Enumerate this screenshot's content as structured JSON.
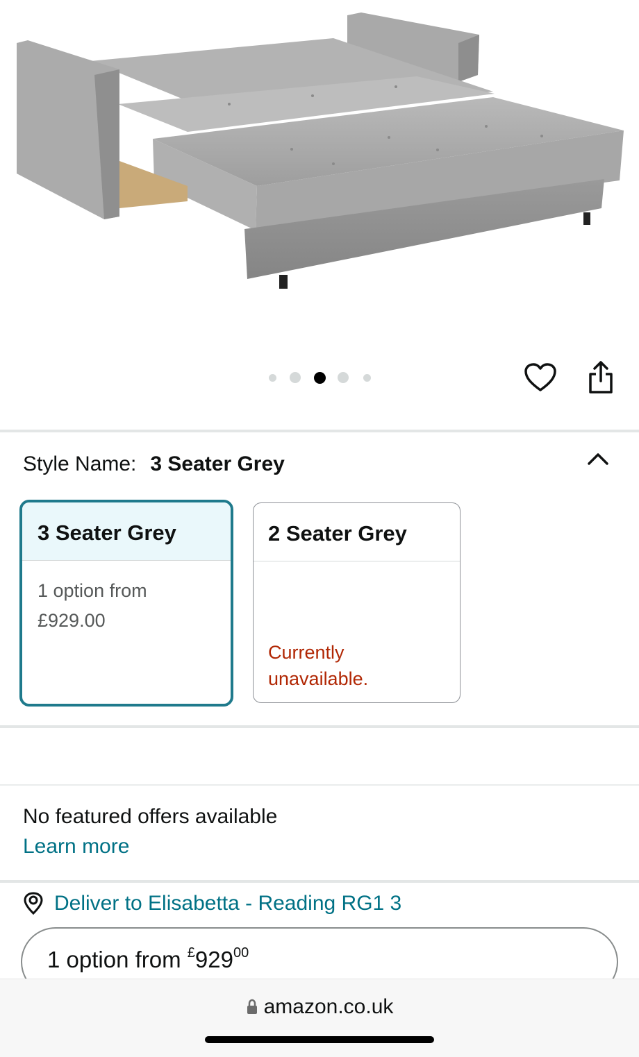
{
  "gallery": {
    "dots": [
      {
        "state": "inactive-small"
      },
      {
        "state": "inactive"
      },
      {
        "state": "active"
      },
      {
        "state": "inactive"
      },
      {
        "state": "inactive-small"
      }
    ],
    "active_index": 2,
    "wishlist_icon": "heart-icon",
    "share_icon": "share-icon"
  },
  "style": {
    "label": "Style Name:",
    "value": "3 Seater Grey",
    "collapse_icon": "chevron-up-icon",
    "options": [
      {
        "name": "3 Seater Grey",
        "line1": "1 option from",
        "line2": "£929.00",
        "selected": true
      },
      {
        "name": "2 Seater Grey",
        "status_line1": "Currently",
        "status_line2": "unavailable.",
        "selected": false
      }
    ]
  },
  "offers": {
    "text": "No featured offers available",
    "link": "Learn more"
  },
  "delivery": {
    "icon": "location-pin-icon",
    "text": "Deliver to Elisabetta - Reading RG1 3"
  },
  "buy_option": {
    "prefix": "1 option from ",
    "currency": "£",
    "whole": "929",
    "fraction": "00"
  },
  "browser": {
    "url": "amazon.co.uk",
    "lock_icon": "lock-icon"
  },
  "colors": {
    "link": "#007185",
    "selected_border": "#1f7a8c",
    "unavailable": "#b12704"
  }
}
